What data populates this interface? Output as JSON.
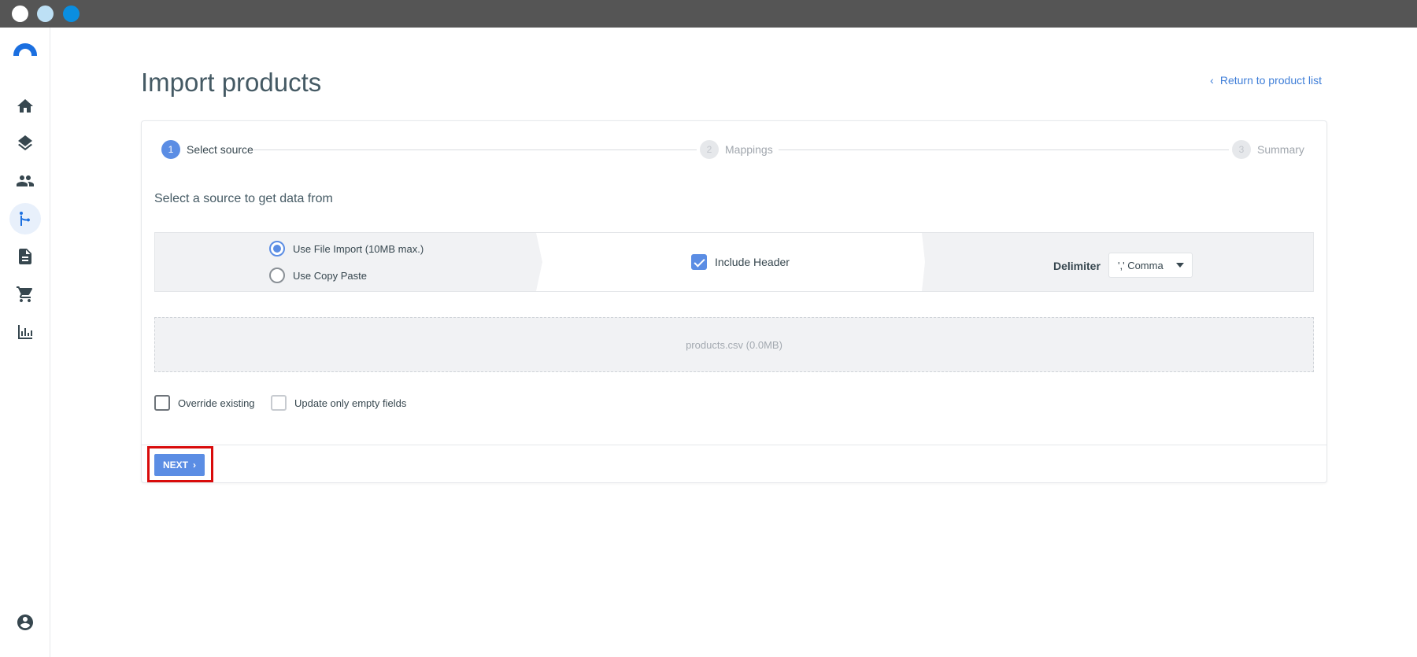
{
  "window": {
    "dots": [
      "#ffffff",
      "#bde0f5",
      "#0a8ee0"
    ]
  },
  "sidebar": {
    "items": [
      {
        "name": "home",
        "icon": "home-icon"
      },
      {
        "name": "catalog",
        "icon": "layers-icon"
      },
      {
        "name": "customers",
        "icon": "people-icon"
      },
      {
        "name": "integrations",
        "icon": "merge-icon",
        "active": true
      },
      {
        "name": "documents",
        "icon": "document-icon"
      },
      {
        "name": "orders",
        "icon": "cart-icon"
      },
      {
        "name": "reports",
        "icon": "bar-chart-icon"
      },
      {
        "name": "account",
        "icon": "account-circle-icon"
      }
    ],
    "accent": "#1b6fe0"
  },
  "page": {
    "title": "Import products",
    "return_link": "Return to product list"
  },
  "stepper": {
    "steps": [
      {
        "num": "1",
        "label": "Select source",
        "state": "active"
      },
      {
        "num": "2",
        "label": "Mappings",
        "state": "todo"
      },
      {
        "num": "3",
        "label": "Summary",
        "state": "todo"
      }
    ]
  },
  "source": {
    "heading": "Select a source to get data from",
    "options": [
      {
        "label": "Use File Import (10MB max.)",
        "selected": true
      },
      {
        "label": "Use Copy Paste",
        "selected": false
      }
    ],
    "include_header": {
      "label": "Include Header",
      "checked": true
    },
    "delimiter": {
      "label": "Delimiter",
      "value": "',' Comma"
    }
  },
  "dropzone": {
    "file": "products.csv (0.0MB)"
  },
  "flags": {
    "override_existing": {
      "label": "Override existing",
      "checked": false
    },
    "update_only_empty": {
      "label": "Update only empty fields",
      "checked": false
    }
  },
  "footer": {
    "next_label": "NEXT"
  },
  "colors": {
    "primary": "#5b8de4",
    "highlight": "#d90b0b"
  }
}
